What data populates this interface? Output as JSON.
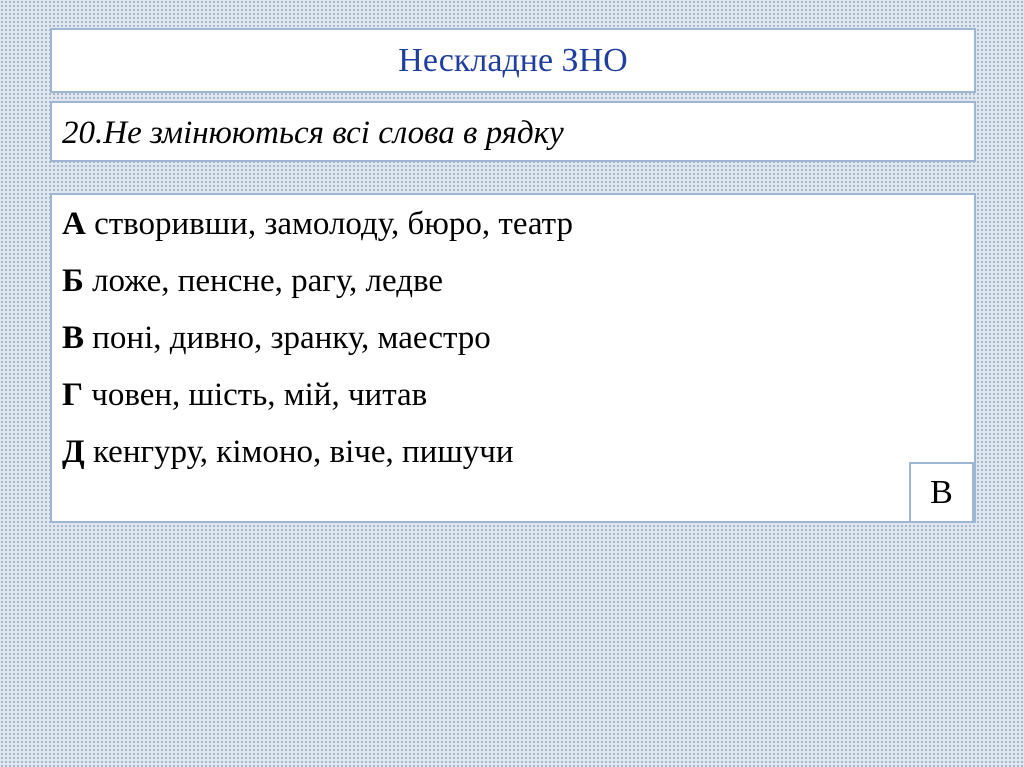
{
  "slide": {
    "title": "Нескладне ЗНО",
    "question": "20.Не змінюються всі слова в рядку",
    "options": [
      {
        "letter": "А",
        "text": " створивши, замолоду, бюро, театр"
      },
      {
        "letter": "Б",
        "text": " ложе, пенсне, рагу, ледве"
      },
      {
        "letter": "В",
        "text": " поні, дивно, зранку, маестро"
      },
      {
        "letter": "Г",
        "text": " човен, шість, мій, читав"
      },
      {
        "letter": "Д",
        "text": " кенгуру, кімоно, віче, пишучи"
      }
    ],
    "answer": "В"
  },
  "colors": {
    "title": "#1f3f9e",
    "border": "#9fb6d3",
    "background": "#dfe6ee"
  }
}
